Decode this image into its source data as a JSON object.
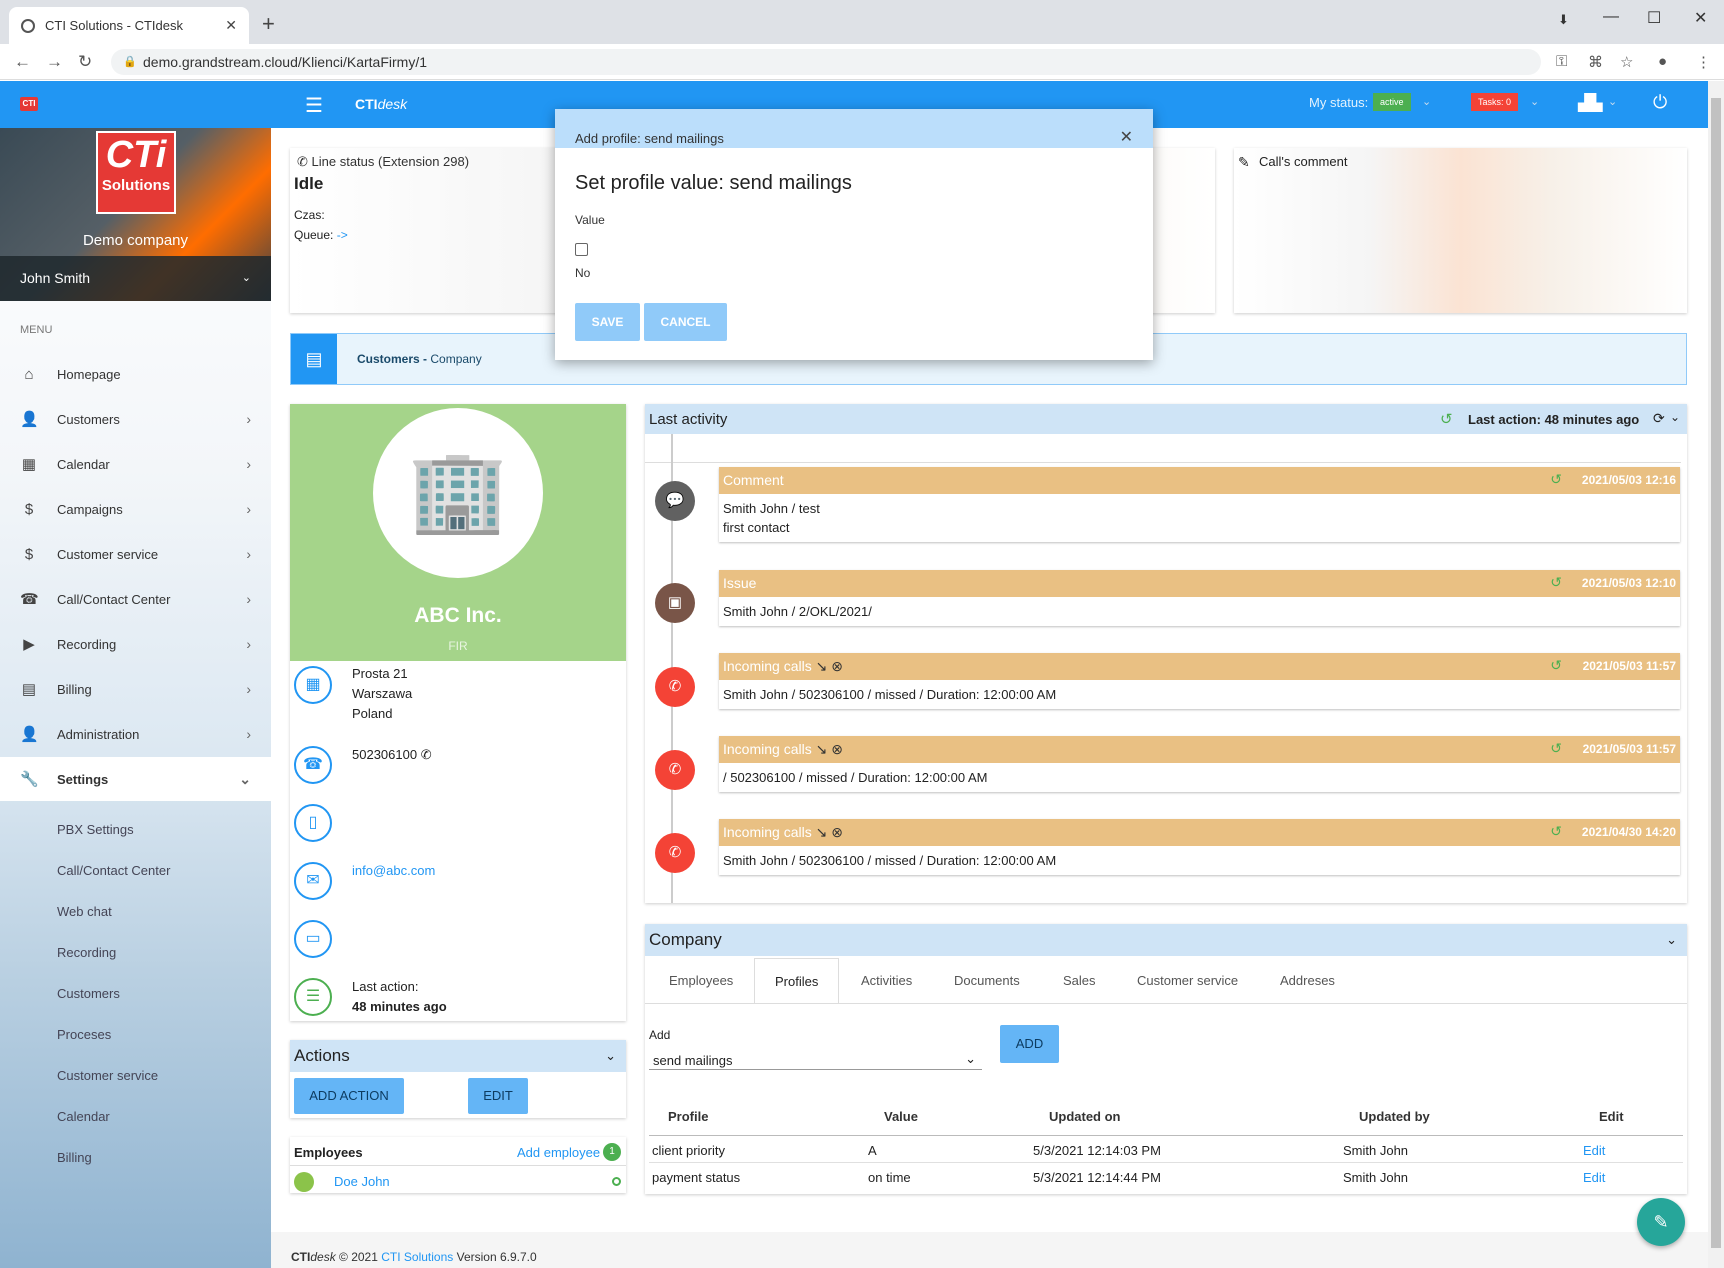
{
  "browser": {
    "tab_title": "CTI Solutions - CTIdesk",
    "url": "demo.grandstream.cloud/Klienci/KartaFirmy/1"
  },
  "header": {
    "logo": "CTI",
    "brand_bold": "CTI",
    "brand_italic": "desk",
    "my_status_label": "My status:",
    "status_badge": "active",
    "tasks_badge": "Tasks: 0"
  },
  "sidebar": {
    "logo_line1": "CTi",
    "logo_line2": "Solutions",
    "company": "Demo company",
    "user": "John Smith",
    "menu_label": "MENU",
    "items": [
      {
        "label": "Homepage",
        "icon": "home-icon"
      },
      {
        "label": "Customers",
        "icon": "customers-icon"
      },
      {
        "label": "Calendar",
        "icon": "calendar-icon"
      },
      {
        "label": "Campaigns",
        "icon": "dollar-icon"
      },
      {
        "label": "Customer service",
        "icon": "dollar-icon"
      },
      {
        "label": "Call/Contact Center",
        "icon": "phone-icon"
      },
      {
        "label": "Recording",
        "icon": "play-icon"
      },
      {
        "label": "Billing",
        "icon": "money-icon"
      },
      {
        "label": "Administration",
        "icon": "admin-icon"
      },
      {
        "label": "Settings",
        "icon": "wrench-icon"
      }
    ],
    "settings_sub": [
      "PBX Settings",
      "Call/Contact Center",
      "Web chat",
      "Recording",
      "Customers",
      "Proceses",
      "Customer service",
      "Calendar",
      "Billing"
    ]
  },
  "line_status": {
    "title": "Line status (Extension 298)",
    "state": "Idle",
    "czas": "Czas:",
    "queue_label": "Queue:",
    "queue_value": "->"
  },
  "calls_comment": "Call's comment",
  "breadcrumb": {
    "part1": "Customers",
    "sep": " - ",
    "part2": "Company"
  },
  "profile": {
    "name": "ABC Inc.",
    "type": "FIR",
    "address": [
      "Prosta 21",
      "Warszawa",
      "Poland"
    ],
    "phone": "502306100",
    "email": "info@abc.com",
    "last_action_label": "Last action:",
    "last_action_value": "48 minutes ago"
  },
  "actions": {
    "title": "Actions",
    "add_action": "ADD ACTION",
    "edit": "EDIT"
  },
  "employees": {
    "title": "Employees",
    "add": "Add employee",
    "count": "1",
    "items": [
      "Doe John"
    ]
  },
  "last_activity": {
    "title": "Last activity",
    "last_action": "Last action: 48 minutes ago",
    "items": [
      {
        "type": "Comment",
        "date": "2021/05/03 12:16",
        "line1": "Smith John / test",
        "line2": "first contact",
        "color": "#616161"
      },
      {
        "type": "Issue",
        "date": "2021/05/03 12:10",
        "line1": "Smith John / 2/OKL/2021/",
        "line2": "",
        "color": "#795548"
      },
      {
        "type": "Incoming calls",
        "date": "2021/05/03 11:57",
        "line1": "Smith John / 502306100 / missed / Duration: 12:00:00 AM",
        "line2": "",
        "color": "#f44336"
      },
      {
        "type": "Incoming calls",
        "date": "2021/05/03 11:57",
        "line1": "/ 502306100 / missed / Duration: 12:00:00 AM",
        "line2": "",
        "color": "#f44336"
      },
      {
        "type": "Incoming calls",
        "date": "2021/04/30 14:20",
        "line1": "Smith John / 502306100 / missed / Duration: 12:00:00 AM",
        "line2": "",
        "color": "#f44336"
      }
    ]
  },
  "company": {
    "title": "Company",
    "tabs": [
      "Employees",
      "Profiles",
      "Activities",
      "Documents",
      "Sales",
      "Customer service",
      "Addreses"
    ],
    "add_label": "Add",
    "select_value": "send mailings",
    "add_button": "ADD",
    "columns": [
      "Profile",
      "Value",
      "Updated on",
      "Updated by",
      "Edit"
    ],
    "rows": [
      {
        "profile": "client priority",
        "value": "A",
        "updated_on": "5/3/2021 12:14:03 PM",
        "updated_by": "Smith John",
        "edit": "Edit"
      },
      {
        "profile": "payment status",
        "value": "on time",
        "updated_on": "5/3/2021 12:14:44 PM",
        "updated_by": "Smith John",
        "edit": "Edit"
      }
    ]
  },
  "footer": {
    "brand_bold": "CTI",
    "brand_italic": "desk",
    "copy": " © 2021 ",
    "link": "CTI Solutions",
    "version": " Version 6.9.7.0"
  },
  "modal": {
    "header": "Add profile: send mailings",
    "title": "Set profile value: send mailings",
    "value_label": "Value",
    "checkbox_text": "No",
    "save": "SAVE",
    "cancel": "CANCEL"
  }
}
